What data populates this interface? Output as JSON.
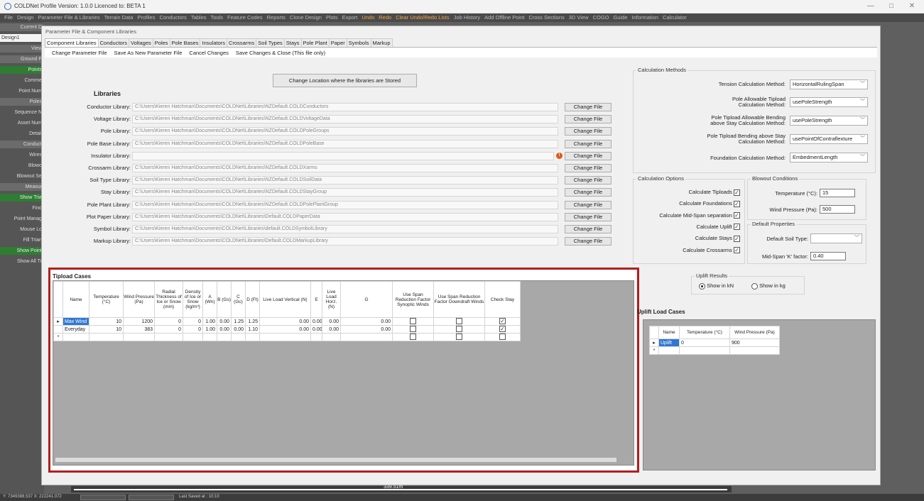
{
  "window": {
    "title": "COLDNet Profile Version: 1.0.0   Licenced to: BETA 1",
    "minimize": "—",
    "restore": "□",
    "close": "✕"
  },
  "menubar": {
    "items": [
      "File",
      "Design",
      "Parameter File & Libraries",
      "Terrain Data",
      "Profiles",
      "Conductors",
      "Tables",
      "Tools",
      "Feature Codes",
      "Reports",
      "Clone Design",
      "Plots",
      "Export"
    ],
    "orange_items": [
      "Undo",
      "Redo",
      "Clear Undo/Redo Lists"
    ],
    "right_items": [
      "Job History",
      "Add Offline Point",
      "Cross Sections",
      "3D View",
      "COGO",
      "Guide",
      "Information",
      "Calculator"
    ]
  },
  "leftbar": {
    "items": [
      {
        "label": "Current D",
        "style": "hdr"
      },
      {
        "label": "Design1",
        "style": "white"
      },
      {
        "label": "View",
        "style": "hdr"
      },
      {
        "label": "Ground P",
        "style": "hdr"
      },
      {
        "label": "Points",
        "style": "green"
      },
      {
        "label": "Comme",
        "style": ""
      },
      {
        "label": "Point Num",
        "style": ""
      },
      {
        "label": "Poles",
        "style": "hdr"
      },
      {
        "label": "Sequence N",
        "style": ""
      },
      {
        "label": "Asset Num",
        "style": ""
      },
      {
        "label": "Detail",
        "style": ""
      },
      {
        "label": "Conduct",
        "style": "hdr"
      },
      {
        "label": "Wires",
        "style": ""
      },
      {
        "label": "Blowo",
        "style": ""
      },
      {
        "label": "Blowout Se",
        "style": ""
      },
      {
        "label": "Measur",
        "style": "hdr"
      },
      {
        "label": "Show Tria",
        "style": "green"
      },
      {
        "label": "Find",
        "style": ""
      },
      {
        "label": "Point Manag",
        "style": ""
      },
      {
        "label": "Mouse Lo",
        "style": ""
      },
      {
        "label": "Fill Trian",
        "style": ""
      },
      {
        "label": "Show Point",
        "style": "green"
      },
      {
        "label": "Show All Tr",
        "style": ""
      }
    ]
  },
  "statusbar": {
    "coords": "Y: 7349388.537 X: 222241.072",
    "saved": "Last Saved at : 10:10"
  },
  "ruler": {
    "label": "339.51m"
  },
  "dialog": {
    "title": "Parameter File & Component Libraries",
    "tabs": [
      "Component Libraries",
      "Conductors",
      "Voltages",
      "Poles",
      "Pole Bases",
      "Insulators",
      "Crossarms",
      "Soil Types",
      "Stays",
      "Pole Plant",
      "Paper",
      "Symbols",
      "Markup"
    ],
    "commands": [
      "Change Parameter File",
      "Save As New Parameter File",
      "Cancel Changes",
      "Save Changes & Close (This file only)"
    ],
    "change_location": "Change Location where the libraries are Stored",
    "libraries_heading": "Libraries",
    "change_file": "Change File",
    "libraries": [
      {
        "label": "Conductor Library:",
        "path": "C:\\Users\\Kieren Hatchman\\Documents\\COLDNet\\Libraries\\NZDefault.COLDConductors"
      },
      {
        "label": "Voltage Library:",
        "path": "C:\\Users\\Kieren Hatchman\\Documents\\COLDNet\\Libraries\\NZDefault.COLDVoltageData"
      },
      {
        "label": "Pole Library:",
        "path": "C:\\Users\\Kieren Hatchman\\Documents\\COLDNet\\Libraries\\NZDefault.COLDPoleGroups"
      },
      {
        "label": "Pole Base Library:",
        "path": "C:\\Users\\Kieren Hatchman\\Documents\\COLDNet\\Libraries\\NZDefault.COLDPoleBase"
      },
      {
        "label": "Insulator Library:",
        "path": ""
      },
      {
        "label": "Crossarm Library:",
        "path": "C:\\Users\\Kieren Hatchman\\Documents\\COLDNet\\Libraries\\NZDefault.COLDXarms"
      },
      {
        "label": "Soil Type Library:",
        "path": "C:\\Users\\Kieren Hatchman\\Documents\\COLDNet\\Libraries\\NZDefault.COLDSoilData"
      },
      {
        "label": "Stay Library:",
        "path": "C:\\Users\\Kieren Hatchman\\Documents\\COLDNet\\Libraries\\NZDefault.COLDStayGroup"
      },
      {
        "label": "Pole Plant Library:",
        "path": "C:\\Users\\Kieren Hatchman\\Documents\\COLDNet\\Libraries\\NZDefault.COLDPolePlantGroup"
      },
      {
        "label": "Plot Paper Library:",
        "path": "C:\\Users\\Kieren Hatchman\\Documents\\COLDNet\\Libraries\\Default.COLDPaperData"
      },
      {
        "label": "Symbol Library:",
        "path": "C:\\Users\\Kieren Hatchman\\Documents\\COLDNet\\Libraries\\default.COLDSymbolLibrary"
      },
      {
        "label": "Markup Library:",
        "path": "C:\\Users\\Kieren Hatchman\\Documents\\COLDNet\\Libraries\\Default.COLDMarkupLibrary"
      }
    ],
    "warn_glyph": "!",
    "calc_methods": {
      "title": "Calculation Methods",
      "tension_label": "Tension Calculation Method:",
      "tension_value": "HorizontalRulingSpan",
      "pole_tipload_label_1": "Pole Allowable Tipload",
      "pole_tipload_label_2": "Calculation Method:",
      "pole_tipload_value": "usePoleStrength",
      "bending_label_1": "Pole Tipload Allowable Bending",
      "bending_label_2": "above Stay Calculation Method:",
      "bending_value": "usePoleStrength",
      "stay_bending_label_1": "Pole Tipload Bending above Stay",
      "stay_bending_label_2": "Calculation Method:",
      "stay_bending_value": "usePointOfContraflexture",
      "foundation_label": "Foundation Calculation Method:",
      "foundation_value": "EmbedmentLength"
    },
    "calc_options": {
      "title": "Calculation Options",
      "items": [
        "Calculate Tiploads",
        "Calculate Foundations",
        "Calculate Mid-Span separation",
        "Calculate Uplift",
        "Calculate Stays",
        "Calculate Crossarms"
      ],
      "checked_mark": "✓"
    },
    "blowout": {
      "title": "Blowout Conditions",
      "temp_label": "Temperature (°C):",
      "temp_value": "15",
      "wind_label": "Wind Pressure (Pa):",
      "wind_value": "500"
    },
    "defaults": {
      "title": "Default Properties",
      "soil_label": "Default Soil Type:",
      "soil_value": "",
      "k_label": "Mid-Span 'K' factor:",
      "k_value": "0.40"
    },
    "uplift_results": {
      "title": "Uplift Results",
      "kn": "Show in kN",
      "kg": "Show in kg"
    },
    "tipload": {
      "title": "Tipload Cases",
      "headers": [
        "Name",
        "Temperature (°C)",
        "Wind Pressure (Pa)",
        "Radial Thickness of Ice or Snow (mm)",
        "Density of Ice or Snow (kg/m³)",
        "A (Wn)",
        "B (Gs)",
        "C (Gc)",
        "D (Ft)",
        "Live Load Vertical (N)",
        "E",
        "Live Load Horz. (N)",
        "G",
        "Use Span Reduction Factor Synoptic Winds",
        "Use Span Reduction Factor Downdraft Winds",
        "Check Stay"
      ],
      "rows": [
        [
          "Max Wind",
          "10",
          "1200",
          "0",
          "0",
          "1.00",
          "0.00",
          "1.25",
          "1.25",
          "0.00",
          "0.00",
          "0.00",
          "0.00"
        ],
        [
          "Everyday",
          "10",
          "383",
          "0",
          "0",
          "1.00",
          "0.00",
          "0.00",
          "1.10",
          "0.00",
          "0.00",
          "0.00",
          "0.00"
        ]
      ],
      "row_marker": "▸",
      "new_row_marker": "*"
    },
    "uplift": {
      "title": "Uplift Load Cases",
      "headers": [
        "Name",
        "Temperature (°C)",
        "Wind Pressure (Pa)"
      ],
      "rows": [
        [
          "Uplift",
          "0",
          "900"
        ]
      ],
      "row_marker": "▸",
      "new_row_marker": "*"
    }
  }
}
